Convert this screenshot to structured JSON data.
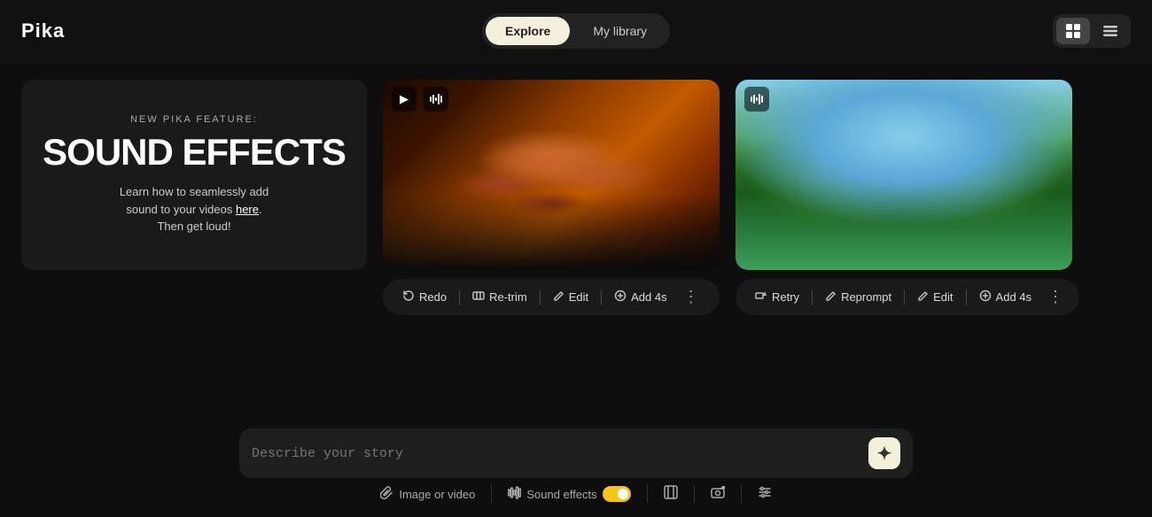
{
  "app": {
    "logo": "Pika"
  },
  "nav": {
    "tabs": [
      {
        "id": "explore",
        "label": "Explore",
        "active": true
      },
      {
        "id": "my-library",
        "label": "My library",
        "active": false
      }
    ]
  },
  "view_toggles": {
    "grid_label": "grid",
    "list_label": "list"
  },
  "promo": {
    "subtitle": "NEW PIKA FEATURE:",
    "title": "SOUND EFFECTS",
    "desc_line1": "Learn how to seamlessly add",
    "desc_line2": "sound to your videos",
    "desc_link": "here",
    "desc_line3": ".",
    "desc_line4": "Then get loud!"
  },
  "video1": {
    "action_bar": {
      "redo": "Redo",
      "retrim": "Re-trim",
      "edit": "Edit",
      "add4s": "Add 4s",
      "more": "⋮"
    }
  },
  "video2": {
    "action_bar": {
      "retry": "Retry",
      "reprompt": "Reprompt",
      "edit": "Edit",
      "add4s": "Add 4s",
      "more": "⋮"
    }
  },
  "input": {
    "placeholder": "Describe your story",
    "plus_icon": "✦"
  },
  "toolbar": {
    "image_video": "Image or video",
    "sound_effects": "Sound effects",
    "icons": {
      "attach": "📎",
      "waveform": "♫",
      "expand": "⛶",
      "camera": "🎬",
      "sliders": "⇌"
    }
  }
}
